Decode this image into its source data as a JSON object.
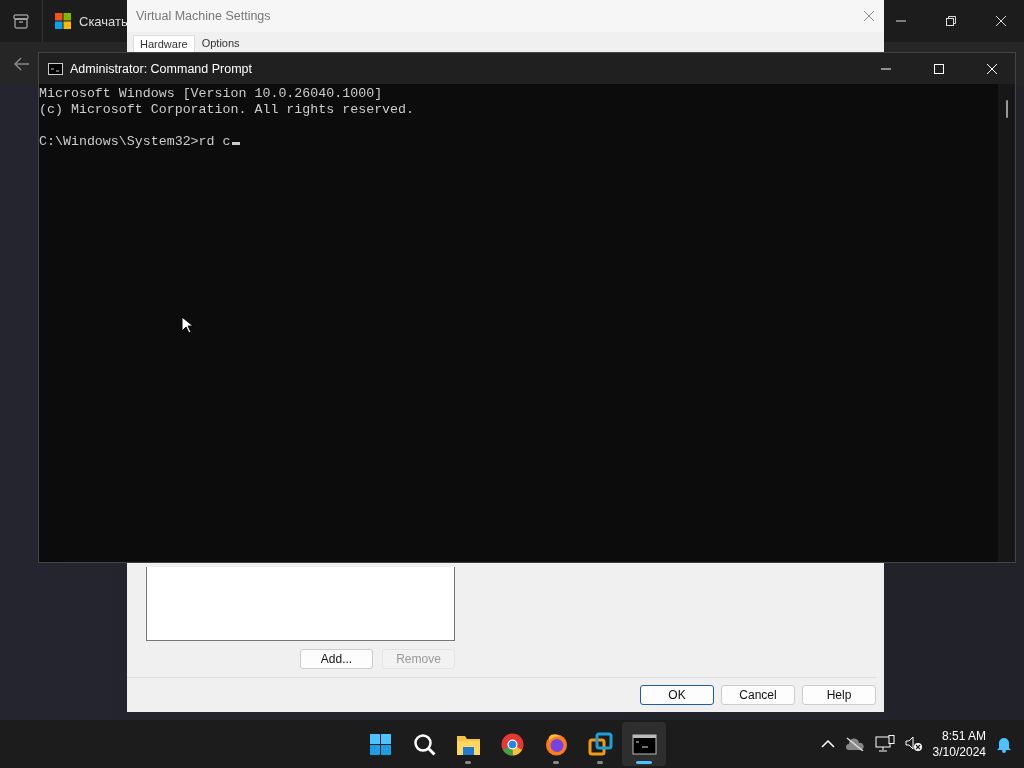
{
  "browser": {
    "tab_title": "Скачать"
  },
  "vm_settings": {
    "title": "Virtual Machine Settings",
    "tabs": [
      {
        "label": "Hardware",
        "selected": true
      },
      {
        "label": "Options",
        "selected": false
      }
    ],
    "list_buttons": [
      {
        "label": "Add...",
        "disabled": false
      },
      {
        "label": "Remove",
        "disabled": true
      }
    ],
    "buttons": [
      {
        "label": "OK",
        "default": true
      },
      {
        "label": "Cancel",
        "default": false
      },
      {
        "label": "Help",
        "default": false
      }
    ]
  },
  "console": {
    "title": "Administrator: Command Prompt",
    "header_lines": [
      "Microsoft Windows [Version 10.0.26040.1000]",
      "(c) Microsoft Corporation. All rights reserved."
    ],
    "prompt": "C:\\Windows\\System32>rd c"
  },
  "taskbar": {
    "apps": [
      {
        "kind": "start",
        "running": false,
        "active": false
      },
      {
        "kind": "search",
        "running": false,
        "active": false
      },
      {
        "kind": "explorer",
        "running": true,
        "active": false
      },
      {
        "kind": "chrome",
        "running": false,
        "active": false
      },
      {
        "kind": "firefox",
        "running": true,
        "active": false
      },
      {
        "kind": "vmware",
        "running": true,
        "active": false
      },
      {
        "kind": "terminal",
        "running": true,
        "active": true
      }
    ],
    "time": "8:51 AM",
    "date": "3/10/2024"
  }
}
